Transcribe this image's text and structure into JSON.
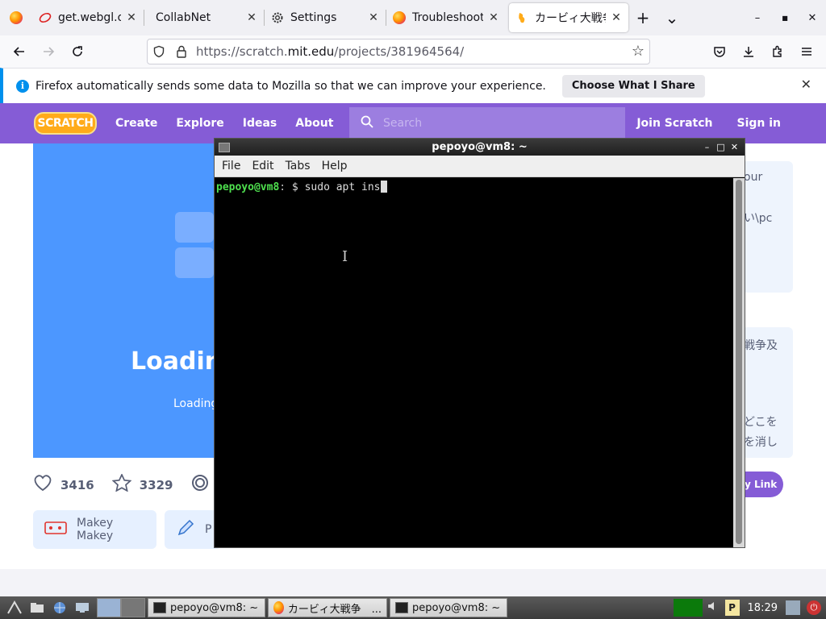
{
  "browser": {
    "tabs": [
      {
        "title": "get.webgl.org/",
        "icon": "webgl-icon",
        "close": "✕",
        "active": false
      },
      {
        "title": "CollabNet",
        "icon": "",
        "close": "✕",
        "active": false
      },
      {
        "title": "Settings",
        "icon": "gear-icon",
        "close": "✕",
        "active": false
      },
      {
        "title": "Troubleshooting",
        "icon": "firefox-icon",
        "close": "✕",
        "active": false
      },
      {
        "title": "カービィ大戦争",
        "icon": "scratch-cat-icon",
        "close": "✕",
        "active": true
      }
    ],
    "new_tab": "+",
    "list_tabs": "⌄",
    "window_controls": {
      "minimize": "–",
      "maximize": "■",
      "close": "✕"
    },
    "url": {
      "prefix": "https://scratch.",
      "domain": "mit.edu",
      "path": "/projects/381964564/"
    }
  },
  "notification": {
    "message": "Firefox automatically sends some data to Mozilla so that we can improve your experience.",
    "button": "Choose What I Share",
    "close": "✕"
  },
  "scratch": {
    "logo": "SCRATCH",
    "nav": [
      "Create",
      "Explore",
      "Ideas",
      "About"
    ],
    "search_placeholder": "Search",
    "join": "Join Scratch",
    "signin": "Sign in",
    "stage": {
      "title": "Loading",
      "subtitle": "Loading"
    },
    "stats": {
      "loves": "3416",
      "favorites": "3329"
    },
    "chips": [
      {
        "label": "Makey Makey"
      },
      {
        "label": "P"
      }
    ],
    "side_card_1": [
      "our",
      "い\\pc"
    ],
    "side_card_2": [
      "戦争及",
      "どこを",
      "を消し"
    ],
    "copy_link": "y Link"
  },
  "terminal": {
    "title": "pepoyo@vm8: ~",
    "menu": [
      "File",
      "Edit",
      "Tabs",
      "Help"
    ],
    "prompt_user": "pepoyo@vm8",
    "prompt_sep": ":",
    "prompt_path": " $ ",
    "command": "sudo apt ins"
  },
  "taskbar": {
    "tasks": [
      {
        "label": "pepoyo@vm8: ~",
        "icon": "terminal"
      },
      {
        "label": "カービィ大戦争　...",
        "icon": "firefox"
      },
      {
        "label": "pepoyo@vm8: ~",
        "icon": "terminal"
      }
    ],
    "tray_p": "P",
    "clock": "18:29"
  }
}
